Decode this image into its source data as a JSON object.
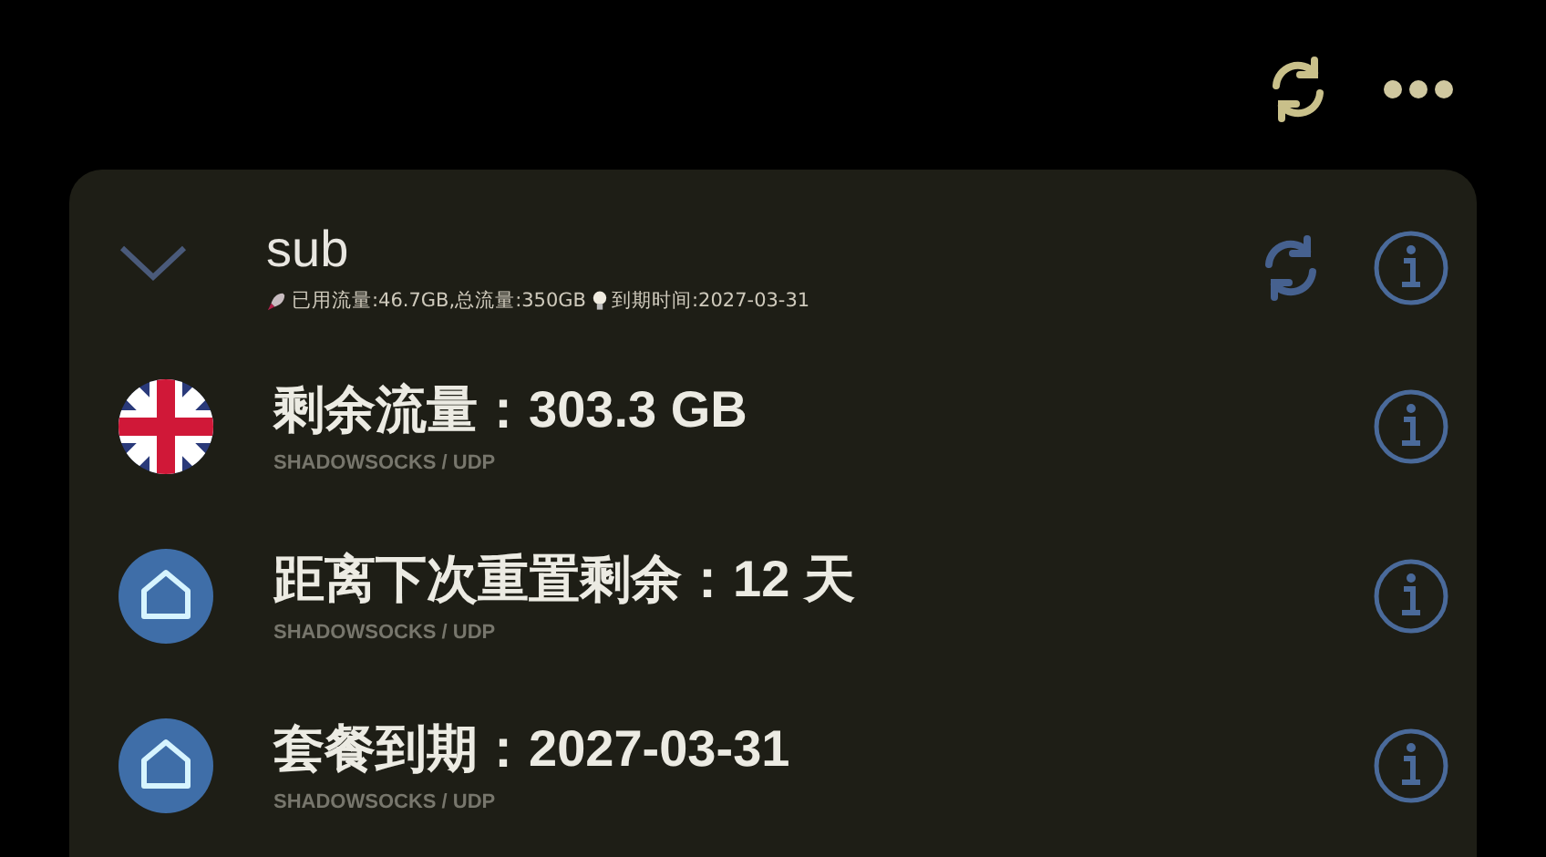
{
  "group": {
    "name": "sub",
    "expanded": true,
    "used_label": "已用流量:46.7GB,总流量:350GB",
    "expiry_label": "到期时间:2027-03-31"
  },
  "items": [
    {
      "title": "剩余流量：303.3 GB",
      "protocol": "SHADOWSOCKS / UDP",
      "kind": "flag"
    },
    {
      "title": "距离下次重置剩余：12 天",
      "protocol": "SHADOWSOCKS / UDP",
      "kind": "home"
    },
    {
      "title": "套餐到期：2027-03-31",
      "protocol": "SHADOWSOCKS / UDP",
      "kind": "home"
    }
  ]
}
